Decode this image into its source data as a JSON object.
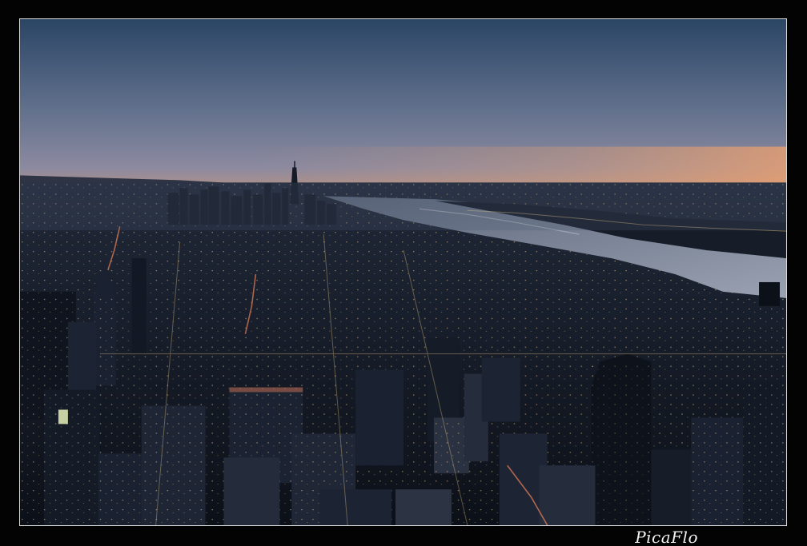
{
  "photo": {
    "subject": "city-skyline-at-dusk",
    "colors": {
      "sky_top": "#2c4566",
      "sky_mid": "#6f7d95",
      "horizon_glow": "#e69a6a",
      "river": "#8c95a6",
      "city_dark": "#111620",
      "city_mid": "#1e2838",
      "window_light": "#f3d28a",
      "street_light": "#ff8a5c"
    }
  },
  "watermark": {
    "text": "PicaFlo"
  },
  "frame": {
    "border_color": "#d8d8d8",
    "background_color": "#030303"
  }
}
